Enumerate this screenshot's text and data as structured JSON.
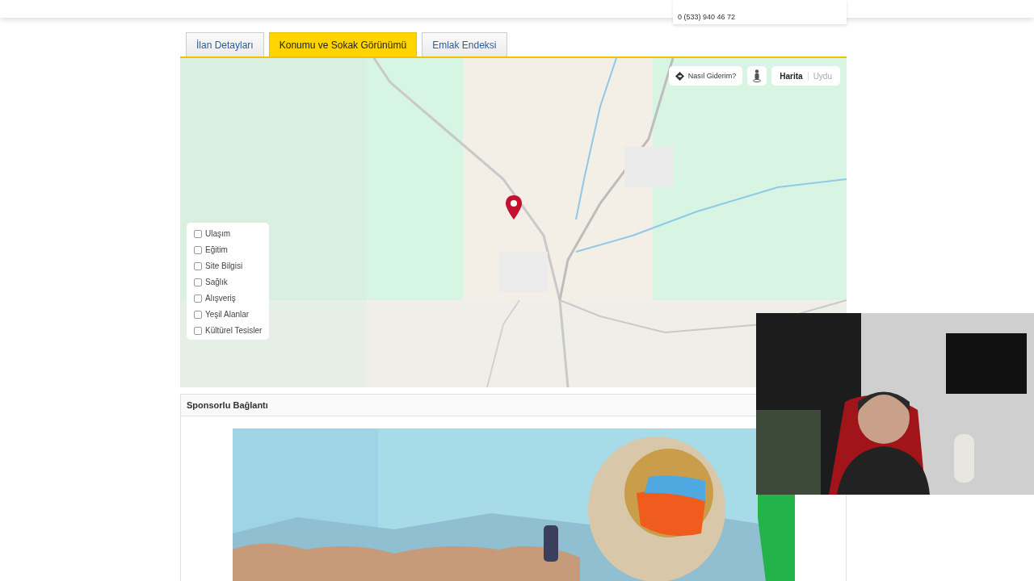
{
  "header": {
    "phone": "0 (533) 940 46 72"
  },
  "tabs": [
    {
      "label": "İlan Detayları",
      "selected": false
    },
    {
      "label": "Konumu ve Sokak Görünümü",
      "selected": true
    },
    {
      "label": "Emlak Endeksi",
      "selected": false
    }
  ],
  "map": {
    "directions_button": "Nasıl Giderim?",
    "map_types": [
      {
        "label": "Harita",
        "selected": true
      },
      {
        "label": "Uydu",
        "selected": false
      }
    ],
    "layers": [
      {
        "label": "Ulaşım",
        "checked": false
      },
      {
        "label": "Eğitim",
        "checked": false
      },
      {
        "label": "Site Bilgisi",
        "checked": false
      },
      {
        "label": "Sağlık",
        "checked": false
      },
      {
        "label": "Alışveriş",
        "checked": false
      },
      {
        "label": "Yeşil Alanlar",
        "checked": false
      },
      {
        "label": "Kültürel Tesisler",
        "checked": false
      }
    ]
  },
  "sponsored": {
    "title": "Sponsorlu Bağlantı"
  }
}
